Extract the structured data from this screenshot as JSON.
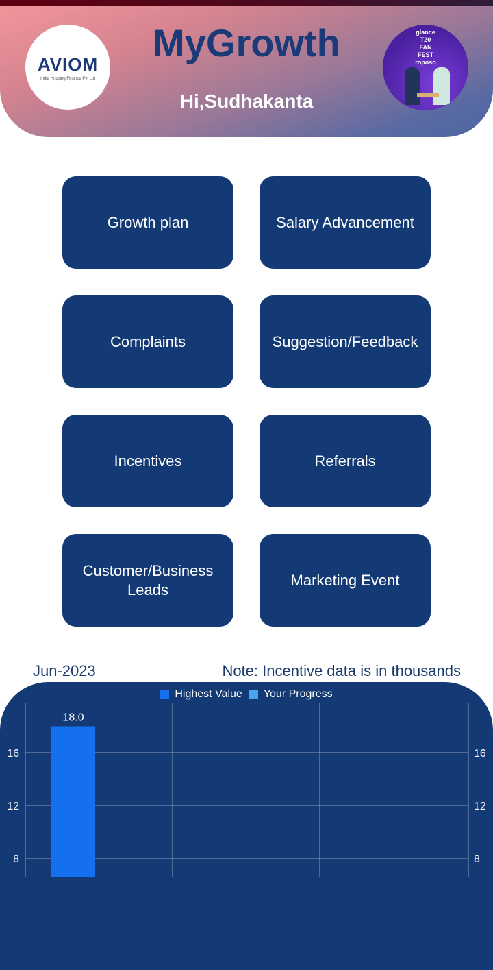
{
  "header": {
    "title": "MyGrowth",
    "greeting": "Hi,Sudhakanta",
    "logo": {
      "brand": "AVIOM",
      "subtitle": "India Housing Finance Pvt Ltd"
    },
    "promo": {
      "text": "glance T20 FAN FEST roposo"
    }
  },
  "menu": [
    {
      "label": "Growth plan"
    },
    {
      "label": "Salary Advancement"
    },
    {
      "label": "Complaints"
    },
    {
      "label": "Suggestion/Feedback"
    },
    {
      "label": "Incentives"
    },
    {
      "label": "Referrals"
    },
    {
      "label": "Customer/Business Leads"
    },
    {
      "label": "Marketing Event"
    }
  ],
  "incentives": {
    "period": "Jun-2023",
    "note": "Note: Incentive data is in thousands"
  },
  "colors": {
    "button": "#133a75",
    "chart_bg": "#143a75",
    "highest": "#1570ef",
    "progress": "#4aa3f0"
  },
  "chart_data": {
    "type": "bar",
    "legend": [
      "Highest Value",
      "Your Progress"
    ],
    "legend_position": "top",
    "series": [
      {
        "name": "Highest Value",
        "values": [
          18.0
        ],
        "labels": [
          "18.0"
        ]
      },
      {
        "name": "Your Progress",
        "values": []
      }
    ],
    "y_ticks": [
      8,
      12,
      16
    ],
    "grid": true
  }
}
